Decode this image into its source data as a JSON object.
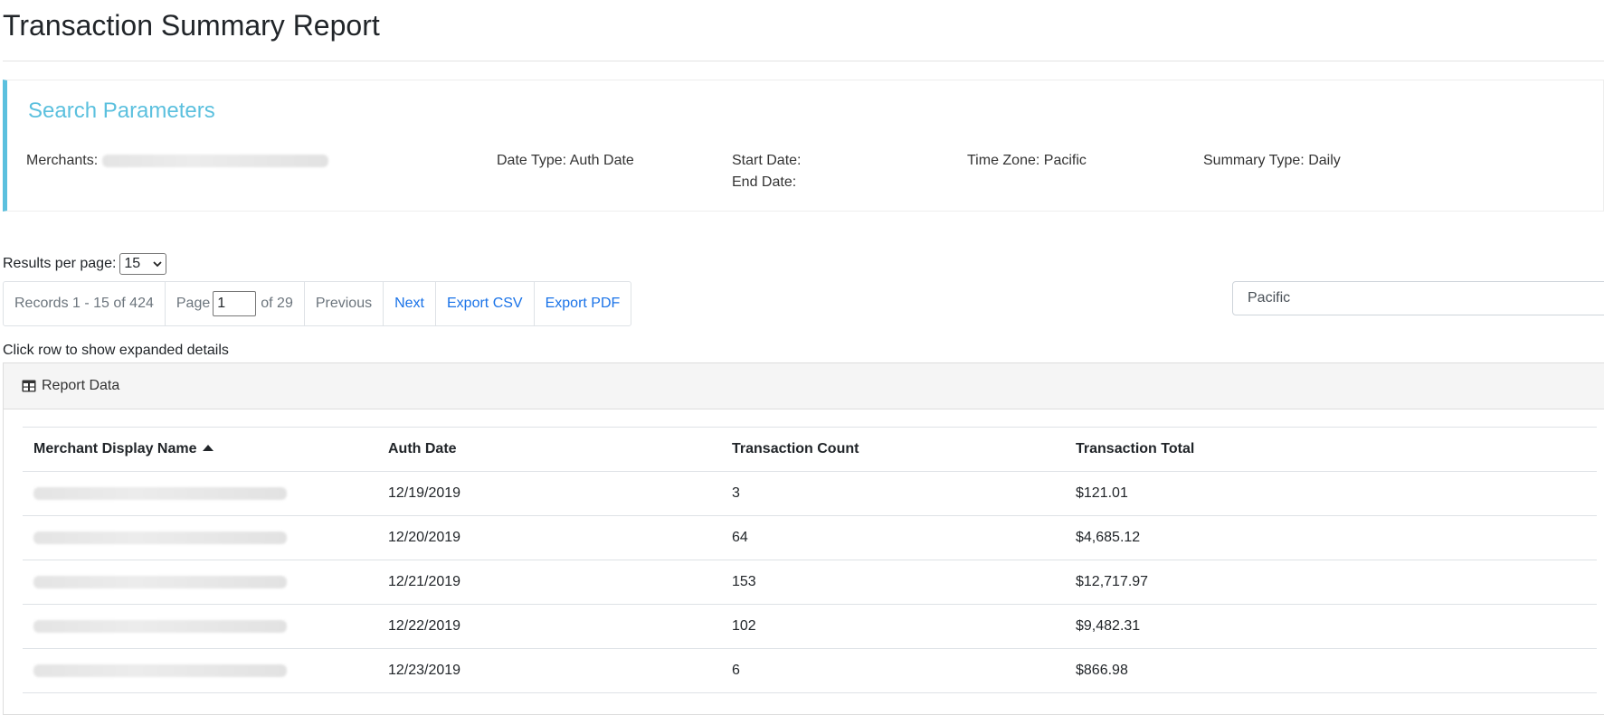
{
  "page": {
    "title": "Transaction Summary Report"
  },
  "search_params": {
    "title": "Search Parameters",
    "merchants_label": "Merchants:",
    "date_type": "Date Type: Auth Date",
    "start_date": "Start Date:",
    "end_date": "End Date:",
    "time_zone": "Time Zone: Pacific",
    "summary_type": "Summary Type: Daily"
  },
  "pagination": {
    "results_per_page_label": "Results per page:",
    "results_per_page_value": "15",
    "records": "Records 1 - 15 of 424",
    "page_label": "Page",
    "page_value": "1",
    "of_pages": "of 29",
    "previous": "Previous",
    "next": "Next",
    "export_csv": "Export CSV",
    "export_pdf": "Export PDF"
  },
  "timezone_select": {
    "value": "Pacific"
  },
  "hint": "Click row to show expanded details",
  "report": {
    "header": "Report Data",
    "columns": [
      "Merchant Display Name",
      "Auth Date",
      "Transaction Count",
      "Transaction Total"
    ],
    "rows": [
      {
        "date": "12/19/2019",
        "count": "3",
        "total": "$121.01"
      },
      {
        "date": "12/20/2019",
        "count": "64",
        "total": "$4,685.12"
      },
      {
        "date": "12/21/2019",
        "count": "153",
        "total": "$12,717.97"
      },
      {
        "date": "12/22/2019",
        "count": "102",
        "total": "$9,482.31"
      },
      {
        "date": "12/23/2019",
        "count": "6",
        "total": "$866.98"
      }
    ]
  },
  "colors": {
    "accent": "#5bc0de",
    "link": "#1a73e8"
  }
}
